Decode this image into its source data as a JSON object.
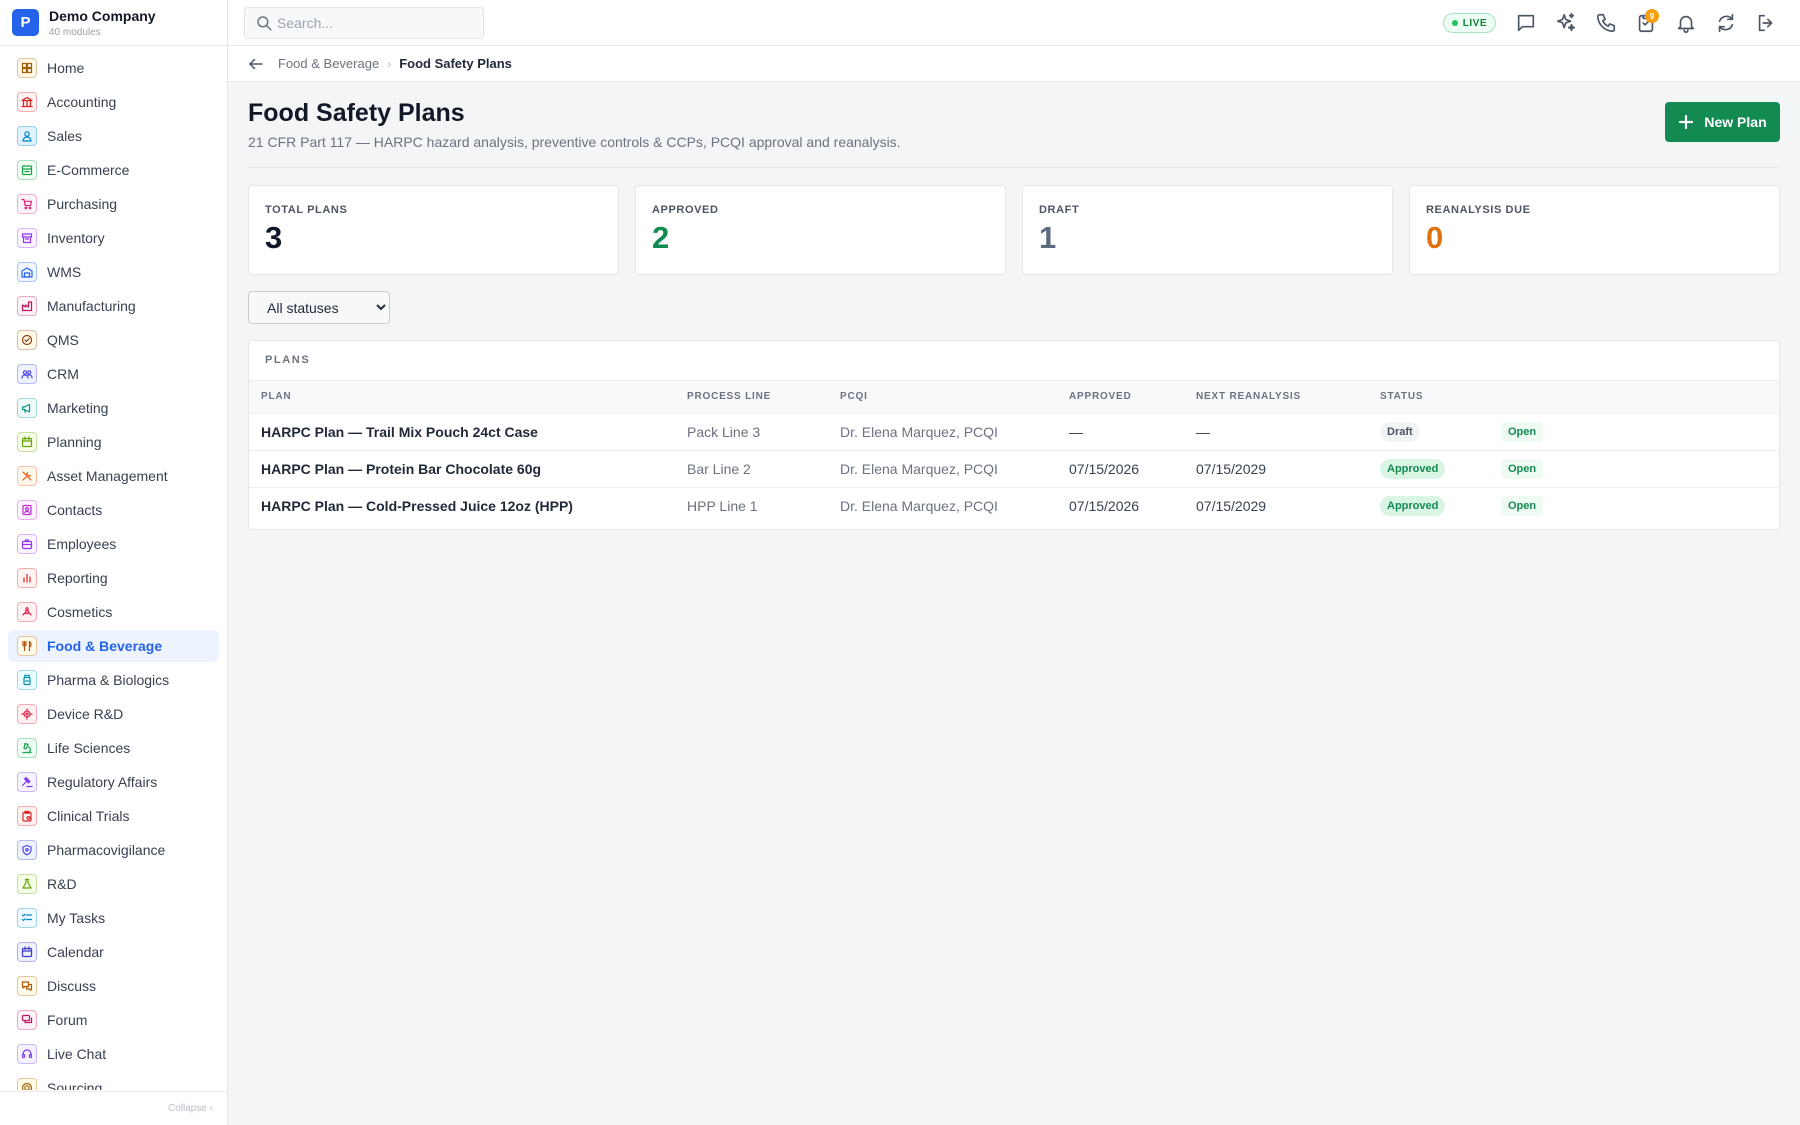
{
  "brand": {
    "initial": "P",
    "name": "Demo Company",
    "sub": "40 modules"
  },
  "sidebar": {
    "items": [
      {
        "label": "Home",
        "icon": "home-grid-icon",
        "color": "#a16207",
        "bg": "#fef9e7"
      },
      {
        "label": "Accounting",
        "icon": "bank-icon",
        "color": "#dc2626",
        "bg": "#fef2f2"
      },
      {
        "label": "Sales",
        "icon": "person-icon",
        "color": "#0284c7",
        "bg": "#e0f2fe"
      },
      {
        "label": "E-Commerce",
        "icon": "cart-storefront-icon",
        "color": "#16a34a",
        "bg": "#f0fdf4"
      },
      {
        "label": "Purchasing",
        "icon": "shopping-cart-icon",
        "color": "#db2777",
        "bg": "#fdf2f8"
      },
      {
        "label": "Inventory",
        "icon": "box-icon",
        "color": "#9333ea",
        "bg": "#faf5ff"
      },
      {
        "label": "WMS",
        "icon": "warehouse-icon",
        "color": "#2563eb",
        "bg": "#eff6ff"
      },
      {
        "label": "Manufacturing",
        "icon": "factory-icon",
        "color": "#be185d",
        "bg": "#fdf2f8"
      },
      {
        "label": "QMS",
        "icon": "badge-check-icon",
        "color": "#92400e",
        "bg": "#fffbeb"
      },
      {
        "label": "CRM",
        "icon": "users-icon",
        "color": "#4f46e5",
        "bg": "#eef2ff"
      },
      {
        "label": "Marketing",
        "icon": "megaphone-icon",
        "color": "#0d9488",
        "bg": "#f0fdfa"
      },
      {
        "label": "Planning",
        "icon": "calendar-icon",
        "color": "#65a30d",
        "bg": "#f7fee7"
      },
      {
        "label": "Asset Management",
        "icon": "tools-icon",
        "color": "#ea580c",
        "bg": "#fff7ed"
      },
      {
        "label": "Contacts",
        "icon": "contact-icon",
        "color": "#c026d3",
        "bg": "#fdf4ff"
      },
      {
        "label": "Employees",
        "icon": "briefcase-icon",
        "color": "#9333ea",
        "bg": "#faf5ff"
      },
      {
        "label": "Reporting",
        "icon": "bar-chart-icon",
        "color": "#dc2626",
        "bg": "#fef2f2"
      },
      {
        "label": "Cosmetics",
        "icon": "flower-icon",
        "color": "#e11d48",
        "bg": "#fff1f2"
      },
      {
        "label": "Food & Beverage",
        "icon": "utensils-icon",
        "color": "#b45309",
        "bg": "#fffbeb"
      },
      {
        "label": "Pharma & Biologics",
        "icon": "pill-bottle-icon",
        "color": "#0891b2",
        "bg": "#ecfeff"
      },
      {
        "label": "Device R&D",
        "icon": "cpu-icon",
        "color": "#e11d48",
        "bg": "#fff1f2"
      },
      {
        "label": "Life Sciences",
        "icon": "microscope-icon",
        "color": "#16a34a",
        "bg": "#f0fdf4"
      },
      {
        "label": "Regulatory Affairs",
        "icon": "gavel-icon",
        "color": "#7c3aed",
        "bg": "#f5f3ff"
      },
      {
        "label": "Clinical Trials",
        "icon": "clipboard-icon",
        "color": "#dc2626",
        "bg": "#fef2f2"
      },
      {
        "label": "Pharmacovigilance",
        "icon": "shield-icon",
        "color": "#4f46e5",
        "bg": "#eef2ff"
      },
      {
        "label": "R&D",
        "icon": "flask-icon",
        "color": "#65a30d",
        "bg": "#f7fee7"
      },
      {
        "label": "My Tasks",
        "icon": "checklist-icon",
        "color": "#0284c7",
        "bg": "#f0f9ff"
      },
      {
        "label": "Calendar",
        "icon": "calendar-icon",
        "color": "#4338ca",
        "bg": "#eef2ff"
      },
      {
        "label": "Discuss",
        "icon": "chat-icon",
        "color": "#b45309",
        "bg": "#fffbeb"
      },
      {
        "label": "Forum",
        "icon": "forum-icon",
        "color": "#be185d",
        "bg": "#fdf2f8"
      },
      {
        "label": "Live Chat",
        "icon": "headset-icon",
        "color": "#7c3aed",
        "bg": "#f5f3ff"
      },
      {
        "label": "Sourcing",
        "icon": "target-icon",
        "color": "#a16207",
        "bg": "#fefce8"
      }
    ],
    "active_index": 17,
    "collapse_label": "Collapse ‹"
  },
  "topbar": {
    "search_placeholder": "Search...",
    "live_label": "LIVE",
    "notification_count": "9",
    "icons": [
      "chat-bubble-icon",
      "sparkles-icon",
      "phone-icon",
      "clipboard-notifications-icon",
      "bell-icon",
      "refresh-icon",
      "logout-icon"
    ]
  },
  "breadcrumb": {
    "parent": "Food & Beverage",
    "separator": "›",
    "current": "Food Safety Plans"
  },
  "page": {
    "title": "Food Safety Plans",
    "subtitle": "21 CFR Part 117 — HARPC hazard analysis, preventive controls & CCPs, PCQI approval and reanalysis.",
    "new_button": "New Plan"
  },
  "kpis": [
    {
      "label": "TOTAL PLANS",
      "value": "3",
      "color": "#111827"
    },
    {
      "label": "APPROVED",
      "value": "2",
      "color": "#138a52"
    },
    {
      "label": "DRAFT",
      "value": "1",
      "color": "#5b6b82"
    },
    {
      "label": "REANALYSIS DUE",
      "value": "0",
      "color": "#e0710f"
    }
  ],
  "filter": {
    "selected": "All statuses"
  },
  "table": {
    "title": "PLANS",
    "columns": [
      "PLAN",
      "PROCESS LINE",
      "PCQI",
      "APPROVED",
      "NEXT REANALYSIS",
      "STATUS",
      ""
    ],
    "rows": [
      {
        "plan": "HARPC Plan — Trail Mix Pouch 24ct Case",
        "line": "Pack Line 3",
        "pcqi": "Dr. Elena Marquez, PCQI",
        "approved": "—",
        "next": "—",
        "status": "Draft",
        "action": "Open"
      },
      {
        "plan": "HARPC Plan — Protein Bar Chocolate 60g",
        "line": "Bar Line 2",
        "pcqi": "Dr. Elena Marquez, PCQI",
        "approved": "07/15/2026",
        "next": "07/15/2029",
        "status": "Approved",
        "action": "Open"
      },
      {
        "plan": "HARPC Plan — Cold-Pressed Juice 12oz (HPP)",
        "line": "HPP Line 1",
        "pcqi": "Dr. Elena Marquez, PCQI",
        "approved": "07/15/2026",
        "next": "07/15/2029",
        "status": "Approved",
        "action": "Open"
      }
    ],
    "status_colors": {
      "Draft": {
        "bg": "#f1f3f5",
        "fg": "#4b5563"
      },
      "Approved": {
        "bg": "#d9f5e4",
        "fg": "#138a52"
      }
    }
  }
}
